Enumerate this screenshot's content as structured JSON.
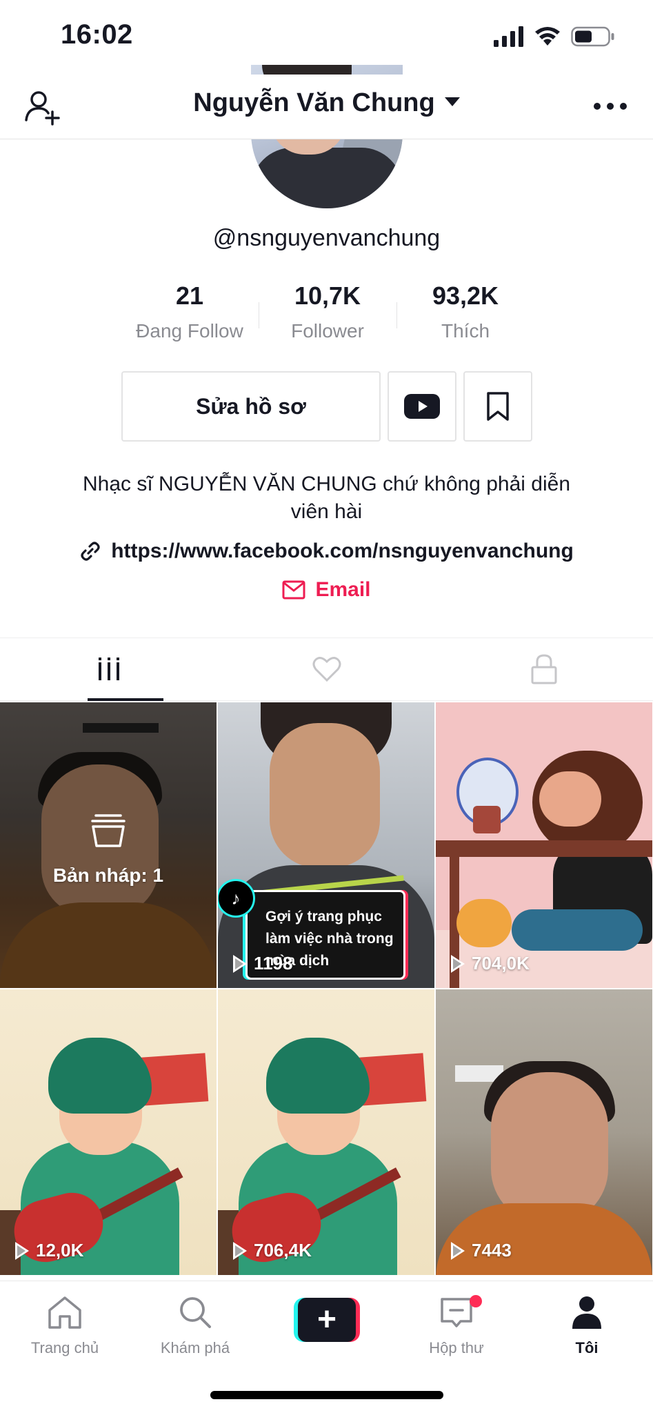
{
  "status_bar": {
    "time": "16:02"
  },
  "header": {
    "title": "Nguyễn Văn Chung"
  },
  "profile": {
    "username": "@nsnguyenvanchung",
    "stats": [
      {
        "value": "21",
        "label": "Đang Follow"
      },
      {
        "value": "10,7K",
        "label": "Follower"
      },
      {
        "value": "93,2K",
        "label": "Thích"
      }
    ],
    "edit_button": "Sửa hồ sơ",
    "bio": "Nhạc sĩ NGUYỄN VĂN CHUNG chứ không phải diễn viên hài",
    "link": "https://www.facebook.com/nsnguyenvanchung",
    "email": "Email"
  },
  "tabs": [
    {
      "icon": "grid-icon",
      "active": true
    },
    {
      "icon": "heart-icon",
      "active": false
    },
    {
      "icon": "lock-icon",
      "active": false
    }
  ],
  "videos": [
    {
      "draft_label": "Bản nháp: 1"
    },
    {
      "caption": "Gợi ý trang phục làm việc nhà trong mùa dịch",
      "views": "1198"
    },
    {
      "views": "704,0K"
    },
    {
      "views": "12,0K"
    },
    {
      "views": "706,4K"
    },
    {
      "views": "7443"
    }
  ],
  "bottom_nav": [
    {
      "label": "Trang chủ",
      "icon": "home-icon"
    },
    {
      "label": "Khám phá",
      "icon": "search-icon"
    },
    {
      "label": "",
      "icon": "plus-icon"
    },
    {
      "label": "Hộp thư",
      "icon": "inbox-icon"
    },
    {
      "label": "Tôi",
      "icon": "profile-icon"
    }
  ],
  "colors": {
    "accent": "#fe2c55",
    "cyan": "#25f4ee",
    "text": "#161823",
    "muted": "#8a8b91"
  }
}
